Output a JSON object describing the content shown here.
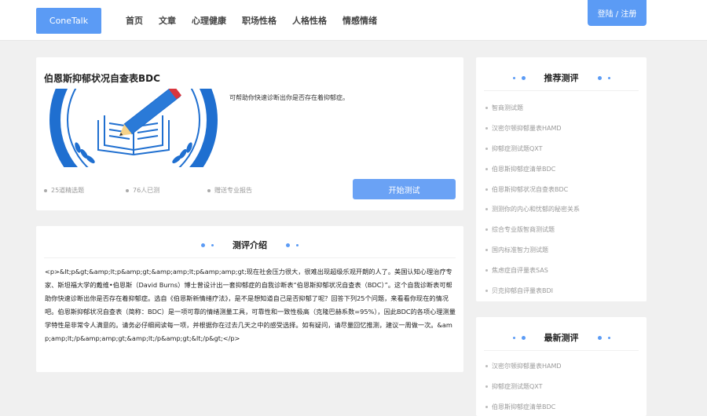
{
  "header": {
    "logo": "ConeTalk",
    "nav": [
      "首页",
      "文章",
      "心理健康",
      "职场性格",
      "人格性格",
      "情感情绪"
    ],
    "login": "登陆 / 注册"
  },
  "test": {
    "title": "伯恩斯抑郁状况自查表BDC",
    "description": "可帮助你快速诊断出你是否存在着抑郁症。",
    "meta": [
      "25道精选题",
      "76人已测",
      "赠送专业报告"
    ],
    "start_button": "开始测试"
  },
  "intro": {
    "heading": "测评介绍",
    "body": "<p>&lt;p&gt;&amp;lt;p&amp;gt;&amp;amp;lt;p&amp;amp;gt;现在社会压力很大，很难出现超级乐观开朗的人了。美国认知心理治疗专家、斯坦福大学的戴维•伯恩斯（David Burns）博士曾设计出一套抑郁症的自我诊断表“伯恩斯抑郁状况自查表（BDC）”。这个自我诊断表可帮助你快速诊断出你是否存在着抑郁症。选自《伯恩斯新情绪疗法》，是不是想知道自己是否抑郁了呢？回答下列25个问题，来看看你现在的情况吧。伯恩斯抑郁状况自查表（简称：BDC）是一项可靠的情绪测量工具，可靠性和一致性极高（克隆巴赫系数=95%），因此BDC的各项心理测量学特性是非常令人满意的。请务必仔细阅读每一项，并根据你在过去几天之中的感受选择。如有疑问，请尽量回忆推测，建议一周做一次。&amp;amp;lt;/p&amp;amp;gt;&amp;lt;/p&amp;gt;&lt;/p&gt;</p>"
  },
  "sidebar": {
    "recommended": {
      "heading": "推荐测评",
      "items": [
        "智商测试题",
        "汉密尔顿抑郁量表HAMD",
        "抑郁症测试题QXT",
        "伯恩斯抑郁症清单BDC",
        "伯恩斯抑郁状况自查表BDC",
        "测测你的内心和忧郁的秘密关系",
        "综合专业版智商测试题",
        "国内标准智力测试题",
        "焦虑症自评量表SAS",
        "贝克抑郁自评量表BDI"
      ]
    },
    "latest": {
      "heading": "最新测评",
      "items": [
        "汉密尔顿抑郁量表HAMD",
        "抑郁症测试题QXT",
        "伯恩斯抑郁症清单BDC"
      ]
    }
  },
  "colors": {
    "accent": "#5b9bf5",
    "page_bg": "#f0f0f0",
    "image_blue": "#1f6fd0"
  },
  "icons": [
    "book-pencil-logo-icon"
  ]
}
